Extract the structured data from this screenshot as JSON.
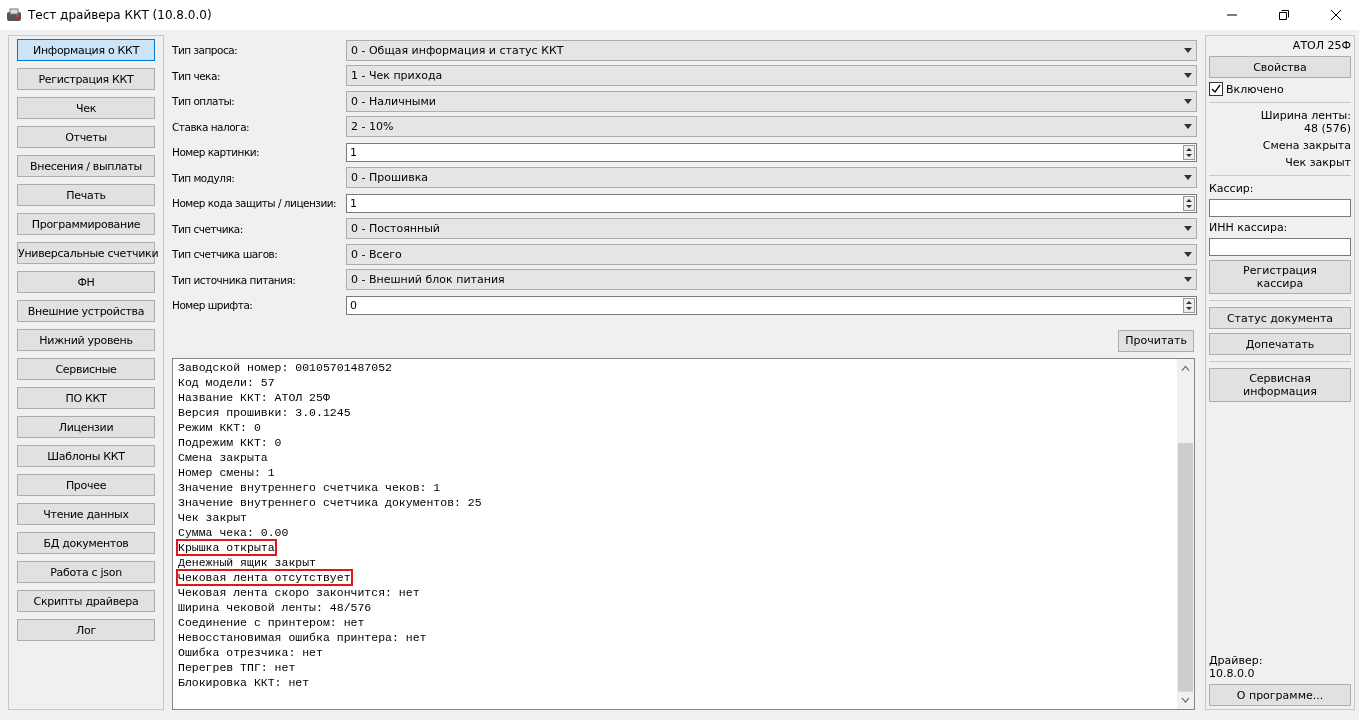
{
  "window": {
    "title": "Тест драйвера ККТ (10.8.0.0)"
  },
  "nav": [
    {
      "label": "Информация о ККТ",
      "selected": true
    },
    {
      "label": "Регистрация ККТ",
      "selected": false
    },
    {
      "label": "Чек",
      "selected": false
    },
    {
      "label": "Отчеты",
      "selected": false
    },
    {
      "label": "Внесения / выплаты",
      "selected": false
    },
    {
      "label": "Печать",
      "selected": false
    },
    {
      "label": "Программирование",
      "selected": false
    },
    {
      "label": "Универсальные счетчики",
      "selected": false
    },
    {
      "label": "ФН",
      "selected": false
    },
    {
      "label": "Внешние устройства",
      "selected": false
    },
    {
      "label": "Нижний уровень",
      "selected": false
    },
    {
      "label": "Сервисные",
      "selected": false
    },
    {
      "label": "ПО ККТ",
      "selected": false
    },
    {
      "label": "Лицензии",
      "selected": false
    },
    {
      "label": "Шаблоны ККТ",
      "selected": false
    },
    {
      "label": "Прочее",
      "selected": false
    },
    {
      "label": "Чтение данных",
      "selected": false
    },
    {
      "label": "БД документов",
      "selected": false
    },
    {
      "label": "Работа с json",
      "selected": false
    },
    {
      "label": "Скрипты драйвера",
      "selected": false
    },
    {
      "label": "Лог",
      "selected": false
    }
  ],
  "form": [
    {
      "label": "Тип запроса:",
      "kind": "select",
      "value": "0 - Общая информация и статус ККТ"
    },
    {
      "label": "Тип чека:",
      "kind": "select",
      "value": "1 - Чек прихода"
    },
    {
      "label": "Тип оплаты:",
      "kind": "select",
      "value": "0 - Наличными"
    },
    {
      "label": "Ставка налога:",
      "kind": "select",
      "value": "2 - 10%"
    },
    {
      "label": "Номер картинки:",
      "kind": "spin",
      "value": "1"
    },
    {
      "label": "Тип модуля:",
      "kind": "select",
      "value": "0 - Прошивка"
    },
    {
      "label": "Номер кода защиты / лицензии:",
      "kind": "spin",
      "value": "1"
    },
    {
      "label": "Тип счетчика:",
      "kind": "select",
      "value": "0 - Постоянный"
    },
    {
      "label": "Тип счетчика шагов:",
      "kind": "select",
      "value": "0 - Всего"
    },
    {
      "label": "Тип источника питания:",
      "kind": "select",
      "value": "0 - Внешний блок питания"
    },
    {
      "label": "Номер шрифта:",
      "kind": "spin",
      "value": "0"
    }
  ],
  "read_button": "Прочитать",
  "output": [
    {
      "text": "Заводской номер: 00105701487052",
      "highlighted": false
    },
    {
      "text": "Код модели: 57",
      "highlighted": false
    },
    {
      "text": "Название ККТ: АТОЛ 25Ф",
      "highlighted": false
    },
    {
      "text": "Версия прошивки: 3.0.1245",
      "highlighted": false
    },
    {
      "text": "Режим ККТ: 0",
      "highlighted": false
    },
    {
      "text": "Подрежим ККТ: 0",
      "highlighted": false
    },
    {
      "text": "Смена закрыта",
      "highlighted": false
    },
    {
      "text": "Номер смены: 1",
      "highlighted": false
    },
    {
      "text": "Значение внутреннего счетчика чеков: 1",
      "highlighted": false
    },
    {
      "text": "Значение внутреннего счетчика документов: 25",
      "highlighted": false
    },
    {
      "text": "Чек закрыт",
      "highlighted": false
    },
    {
      "text": "Сумма чека: 0.00",
      "highlighted": false
    },
    {
      "text": "Крышка открыта",
      "highlighted": true
    },
    {
      "text": "Денежный ящик закрыт",
      "highlighted": false
    },
    {
      "text": "Чековая лента отсутствует",
      "highlighted": true
    },
    {
      "text": "Чековая лента скоро закончится: нет",
      "highlighted": false
    },
    {
      "text": "Ширина чековой ленты: 48/576",
      "highlighted": false
    },
    {
      "text": "Соединение с принтером: нет",
      "highlighted": false
    },
    {
      "text": "Невосстановимая ошибка принтера: нет",
      "highlighted": false
    },
    {
      "text": "Ошибка отрезчика: нет",
      "highlighted": false
    },
    {
      "text": "Перегрев ТПГ: нет",
      "highlighted": false
    },
    {
      "text": "Блокировка ККТ: нет",
      "highlighted": false
    }
  ],
  "side": {
    "model": "АТОЛ 25Ф",
    "properties_button": "Свойства",
    "enabled": {
      "label": "Включено",
      "checked": true
    },
    "tape_width_label": "Ширина ленты:",
    "tape_width": "48 (576)",
    "shift_status": "Смена закрыта",
    "receipt_status": "Чек закрыт",
    "cashier_label": "Кассир:",
    "cashier_inn_label": "ИНН кассира:",
    "register_cashier_button": "Регистрация кассира",
    "document_status_button": "Статус документа",
    "reprint_button": "Допечатать",
    "service_info_button": "Сервисная информация",
    "driver_label": "Драйвер:",
    "driver_version": "10.8.0.0",
    "about_button": "О программе..."
  }
}
